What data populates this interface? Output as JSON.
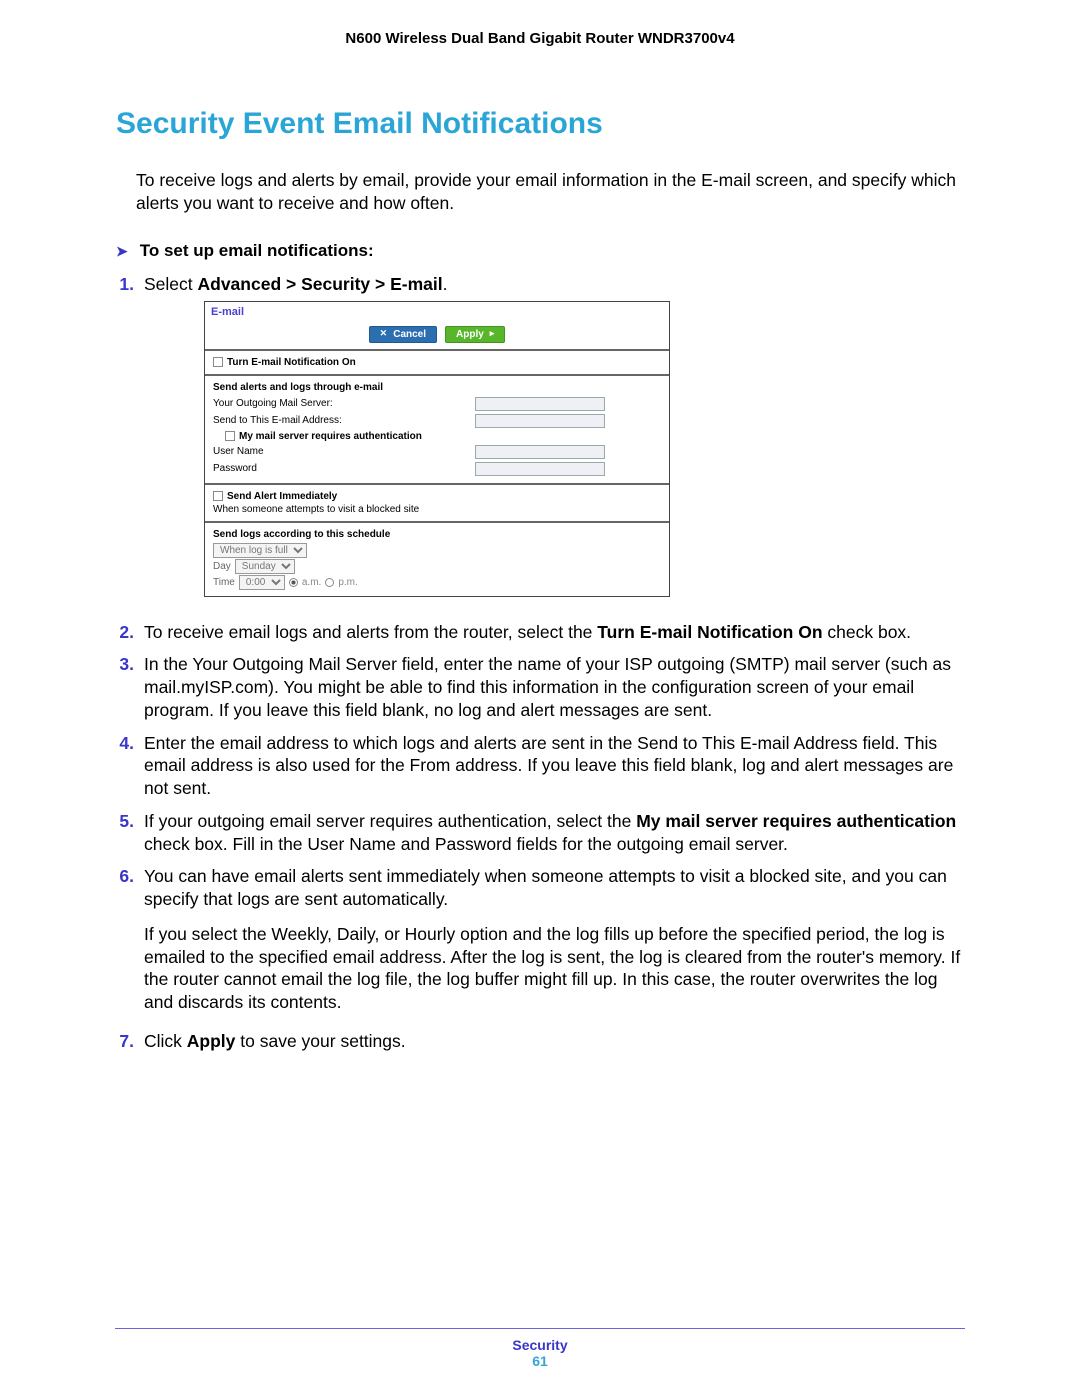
{
  "header": {
    "product": "N600 Wireless Dual Band Gigabit Router WNDR3700v4"
  },
  "section": {
    "title": "Security Event Email Notifications"
  },
  "intro": "To receive logs and alerts by email, provide your email information in the E-mail screen, and specify which alerts you want to receive and how often.",
  "procedure": {
    "heading": "To set up email notifications:"
  },
  "steps": {
    "s1": {
      "pre": "Select ",
      "bold": "Advanced > Security > E-mail",
      "post": "."
    },
    "s2": {
      "pre": "To receive email logs and alerts from the router, select the ",
      "bold": "Turn E-mail Notification On",
      "post": " check box."
    },
    "s3": "In the Your Outgoing Mail Server field, enter the name of your ISP outgoing (SMTP) mail server (such as mail.myISP.com). You might be able to find this information in the configuration screen of your email program. If you leave this field blank, no log and alert messages are sent.",
    "s4": "Enter the email address to which logs and alerts are sent in the Send to This E-mail Address field. This email address is also used for the From address. If you leave this field blank, log and alert messages are not sent.",
    "s5": {
      "pre": "If your outgoing email server requires authentication, select the ",
      "bold": "My mail server requires authentication",
      "post": " check box. Fill in the User Name and Password fields for the outgoing email server."
    },
    "s6": {
      "main": "You can have email alerts sent immediately when someone attempts to visit a blocked site, and you can specify that logs are sent automatically.",
      "sub": "If you select the Weekly, Daily, or Hourly option and the log fills up before the specified period, the log is emailed to the specified email address. After the log is sent, the log is cleared from the router's memory. If the router cannot email the log file, the log buffer might fill up. In this case, the router overwrites the log and discards its contents."
    },
    "s7": {
      "pre": "Click ",
      "bold": "Apply",
      "post": " to save your settings."
    }
  },
  "shot": {
    "title": "E-mail",
    "cancel": "Cancel",
    "apply": "Apply",
    "turn_on": "Turn E-mail Notification On",
    "send_alerts_head": "Send alerts and logs through e-mail",
    "outgoing": "Your Outgoing Mail Server:",
    "sendto": "Send to This E-mail Address:",
    "auth": "My mail server requires authentication",
    "user": "User Name",
    "pass": "Password",
    "alert_head": "Send Alert Immediately",
    "alert_sub": "When someone attempts to visit a blocked site",
    "sched_head": "Send logs according to this schedule",
    "when": "When log is full",
    "day_k": "Day",
    "day_v": "Sunday",
    "time_k": "Time",
    "time_v": "0:00",
    "am": "a.m.",
    "pm": "p.m."
  },
  "footer": {
    "chapter": "Security",
    "page": "61"
  }
}
